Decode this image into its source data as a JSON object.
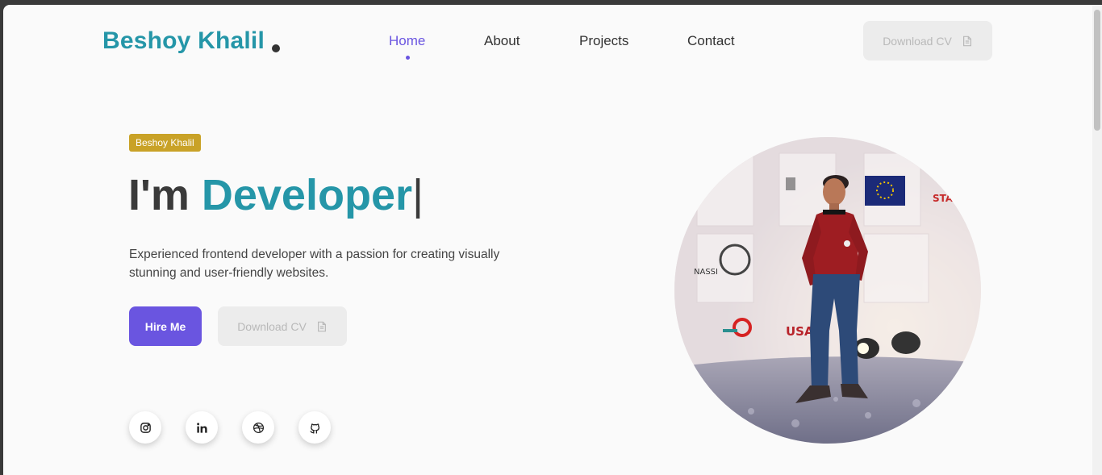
{
  "header": {
    "logo": "Beshoy Khalil",
    "nav": [
      {
        "label": "Home",
        "active": true
      },
      {
        "label": "About",
        "active": false
      },
      {
        "label": "Projects",
        "active": false
      },
      {
        "label": "Contact",
        "active": false
      }
    ],
    "download_cv_label": "Download CV"
  },
  "hero": {
    "badge": "Beshoy Khalil",
    "headline_prefix": "I'm",
    "headline_role": "Developer",
    "caret": "|",
    "description": "Experienced frontend developer with a passion for creating visually stunning and user-friendly websites.",
    "hire_label": "Hire Me",
    "download_cv_label": "Download CV"
  },
  "social": [
    {
      "name": "instagram-icon"
    },
    {
      "name": "linkedin-icon"
    },
    {
      "name": "dribbble-icon"
    },
    {
      "name": "github-icon"
    }
  ],
  "colors": {
    "accent_teal": "#2596a8",
    "accent_purple": "#6a55e0",
    "badge_gold": "#c9a227"
  }
}
